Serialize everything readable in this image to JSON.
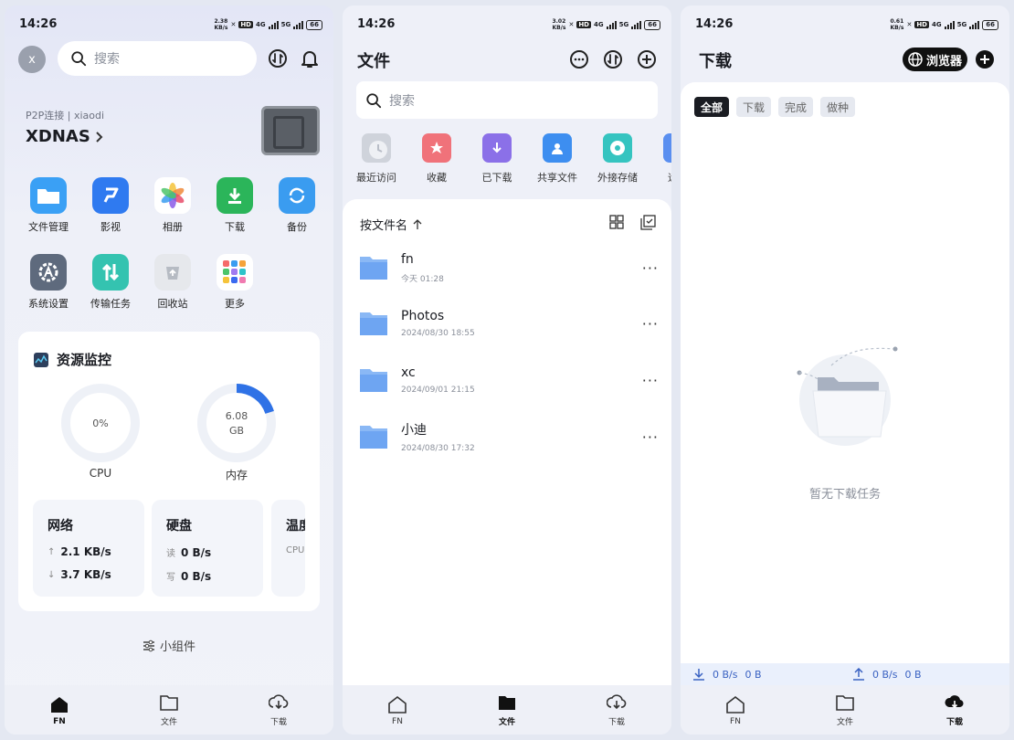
{
  "panels": [
    {
      "status": {
        "time": "14:26",
        "speed_val": "2.38",
        "speed_unit": "KB/s",
        "hd": "HD",
        "net1": "4G",
        "net2": "5G",
        "battery": "66"
      }
    },
    {
      "status": {
        "time": "14:26",
        "speed_val": "3.02",
        "speed_unit": "KB/s",
        "hd": "HD",
        "net1": "4G",
        "net2": "5G",
        "battery": "66"
      }
    },
    {
      "status": {
        "time": "14:26",
        "speed_val": "0.61",
        "speed_unit": "KB/s",
        "hd": "HD",
        "net1": "4G",
        "net2": "5G",
        "battery": "66"
      }
    }
  ],
  "home": {
    "avatar": "x",
    "search_placeholder": "搜索",
    "connection": "P2P连接 | xiaodi",
    "nas_name": "XDNAS",
    "apps": [
      {
        "label": "文件管理",
        "icon": "folder-icon",
        "color": "#3aa0f5"
      },
      {
        "label": "影视",
        "icon": "video-icon",
        "color": "#2f7af0"
      },
      {
        "label": "相册",
        "icon": "photos-icon",
        "color": "#ffffff"
      },
      {
        "label": "下载",
        "icon": "download-icon",
        "color": "#2bb55a"
      },
      {
        "label": "备份",
        "icon": "backup-icon",
        "color": "#3a9cf0"
      },
      {
        "label": "系统设置",
        "icon": "settings-icon",
        "color": "#5e6a7d"
      },
      {
        "label": "传输任务",
        "icon": "transfer-icon",
        "color": "#34c3b0"
      },
      {
        "label": "回收站",
        "icon": "recycle-icon",
        "color": "#e6e8ec"
      },
      {
        "label": "更多",
        "icon": "more-apps-icon",
        "color": "#ffffff"
      }
    ],
    "monitor": {
      "title": "资源监控",
      "cpu_value": "0%",
      "cpu_label": "CPU",
      "cpu_fraction": 0.0,
      "mem_value": "6.08",
      "mem_unit": "GB",
      "mem_label": "内存",
      "mem_fraction": 0.2,
      "network": {
        "title": "网络",
        "up": "2.1 KB/s",
        "down": "3.7 KB/s"
      },
      "disk": {
        "title": "硬盘",
        "read_key": "读",
        "read": "0 B/s",
        "write_key": "写",
        "write": "0 B/s"
      },
      "temp": {
        "title": "温度",
        "sub": "CPU"
      }
    },
    "widget_label": "小组件"
  },
  "files": {
    "title": "文件",
    "search_placeholder": "搜索",
    "quick": [
      {
        "label": "最近访问",
        "color": "#b8bdc7"
      },
      {
        "label": "收藏",
        "color": "#f0727a"
      },
      {
        "label": "已下载",
        "color": "#8b70e8"
      },
      {
        "label": "共享文件",
        "color": "#3d8ef0"
      },
      {
        "label": "外接存储",
        "color": "#35c4c0"
      },
      {
        "label": "远程",
        "color": "#5a8ff0"
      }
    ],
    "sort_label": "按文件名",
    "items": [
      {
        "name": "fn",
        "date": "今天 01:28"
      },
      {
        "name": "Photos",
        "date": "2024/08/30 18:55"
      },
      {
        "name": "xc",
        "date": "2024/09/01 21:15"
      },
      {
        "name": "小迪",
        "date": "2024/08/30 17:32"
      }
    ]
  },
  "downloads": {
    "title": "下载",
    "browser_label": "浏览器",
    "chips": [
      "全部",
      "下载",
      "完成",
      "做种"
    ],
    "empty": "暂无下载任务",
    "down_speed": "0 B/s",
    "down_size": "0 B",
    "up_speed": "0 B/s",
    "up_size": "0 B"
  },
  "tabs": [
    "FN",
    "文件",
    "下载"
  ]
}
